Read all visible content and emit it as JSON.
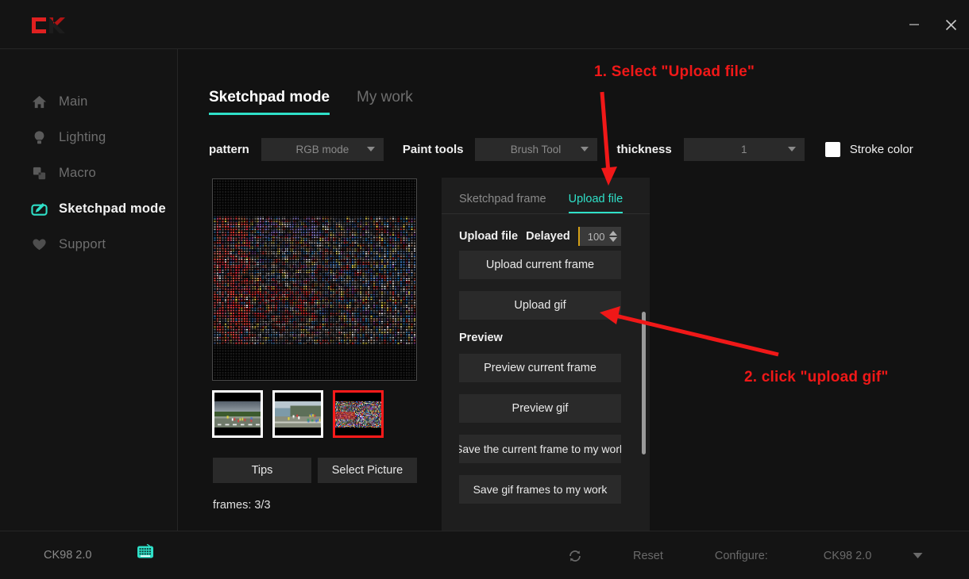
{
  "window": {
    "logo": "CK",
    "minimize_label": "minimize",
    "close_label": "close"
  },
  "sidebar": {
    "items": [
      {
        "label": "Main",
        "icon": "home-icon",
        "active": false
      },
      {
        "label": "Lighting",
        "icon": "lightbulb-icon",
        "active": false
      },
      {
        "label": "Macro",
        "icon": "macro-icon",
        "active": false
      },
      {
        "label": "Sketchpad mode",
        "icon": "sketchpad-icon",
        "active": true
      },
      {
        "label": "Support",
        "icon": "heart-icon",
        "active": false
      }
    ]
  },
  "main": {
    "tabs": [
      {
        "label": "Sketchpad mode",
        "active": true
      },
      {
        "label": "My work",
        "active": false
      }
    ],
    "toolbar": {
      "pattern_label": "pattern",
      "pattern_value": "RGB mode",
      "paint_tools_label": "Paint tools",
      "paint_tools_value": "Brush Tool",
      "thickness_label": "thickness",
      "thickness_value": "1",
      "stroke_color_label": "Stroke color",
      "stroke_color_hex": "#ffffff"
    },
    "thumbnails": [
      {
        "name": "frame-1",
        "selected": false
      },
      {
        "name": "frame-2",
        "selected": false
      },
      {
        "name": "frame-3",
        "selected": true
      }
    ],
    "tips_label": "Tips",
    "select_picture_label": "Select Picture",
    "frames_label": "frames: 3/3"
  },
  "panel": {
    "tabs": [
      {
        "label": "Sketchpad frame",
        "active": false
      },
      {
        "label": "Upload file",
        "active": true
      }
    ],
    "upload_file_label": "Upload file",
    "delayed_label": "Delayed",
    "delayed_value": "100",
    "upload_current_frame_label": "Upload current frame",
    "upload_gif_label": "Upload gif",
    "preview_heading": "Preview",
    "preview_current_frame_label": "Preview current frame",
    "preview_gif_label": "Preview gif",
    "save_current_frame_label": "Save the current frame to my work",
    "save_gif_label": "Save gif frames to my work"
  },
  "statusbar": {
    "device_name": "CK98 2.0",
    "refresh_icon": "refresh-icon",
    "reset_label": "Reset",
    "configure_label": "Configure:",
    "configure_value": "CK98 2.0"
  },
  "annotations": [
    {
      "text": "1. Select \"Upload file\""
    },
    {
      "text": "2. click \"upload gif\""
    }
  ],
  "colors": {
    "accent": "#2fe0c8",
    "annotation": "#f01818",
    "logo_red": "#e02020"
  }
}
